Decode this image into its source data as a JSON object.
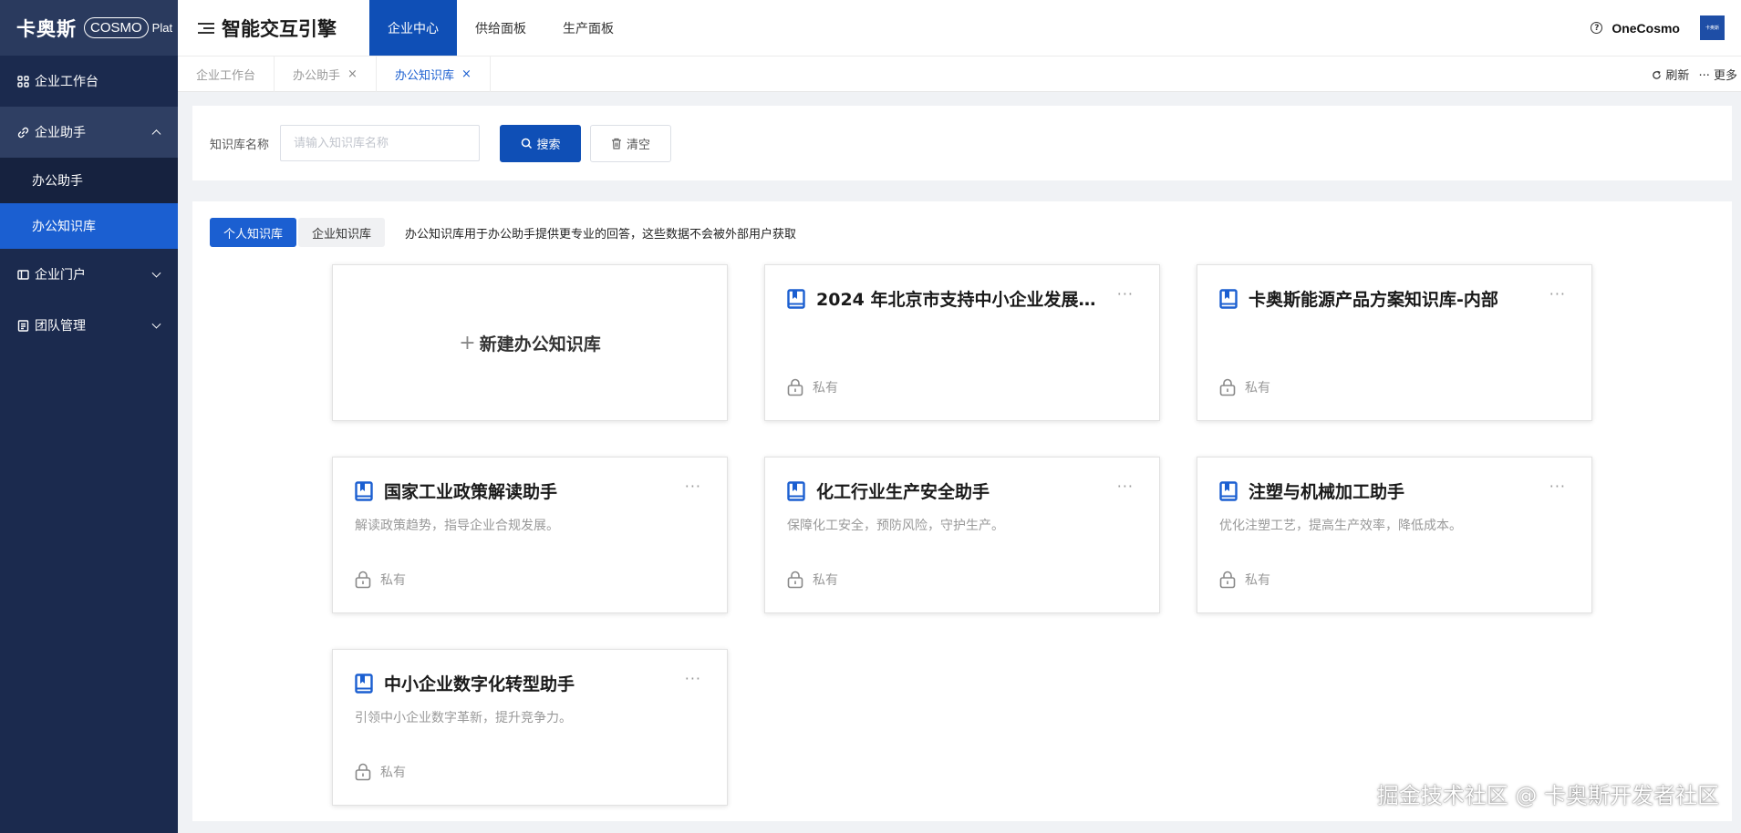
{
  "sidebar": {
    "logo_cn": "卡奥斯",
    "logo_en": "COSMO",
    "logo_plat": "Plat",
    "items": [
      {
        "label": "企业工作台",
        "icon": "grid-icon"
      },
      {
        "label": "企业助手",
        "icon": "link-icon",
        "expanded": true,
        "children": [
          {
            "label": "办公助手"
          },
          {
            "label": "办公知识库",
            "active": true
          }
        ]
      },
      {
        "label": "企业门户",
        "icon": "portal-icon"
      },
      {
        "label": "团队管理",
        "icon": "team-icon"
      }
    ]
  },
  "topbar": {
    "title": "智能交互引擎",
    "tabs": [
      {
        "label": "企业中心",
        "active": true
      },
      {
        "label": "供给面板"
      },
      {
        "label": "生产面板"
      }
    ],
    "help_glyph": "?",
    "brand": "OneCosmo",
    "avatar_text": "卡奥斯"
  },
  "page_tabs": {
    "tabs": [
      {
        "label": "企业工作台",
        "closable": false
      },
      {
        "label": "办公助手",
        "closable": true
      },
      {
        "label": "办公知识库",
        "closable": true,
        "active": true
      }
    ],
    "close_glyph": "×",
    "refresh_label": "刷新",
    "more_label": "更多"
  },
  "search": {
    "label": "知识库名称",
    "placeholder": "请输入知识库名称",
    "value": "",
    "search_label": "搜索",
    "clear_label": "清空"
  },
  "main": {
    "segments": [
      {
        "label": "个人知识库",
        "active": true
      },
      {
        "label": "企业知识库"
      }
    ],
    "description": "办公知识库用于办公助手提供更专业的回答，这些数据不会被外部用户获取",
    "new_card_plus": "+",
    "new_card_label": "新建办公知识库",
    "more_glyph": "···",
    "cards": [
      {
        "title": "2024 年北京市支持中小企业发展…",
        "desc": "",
        "visibility": "私有"
      },
      {
        "title": "卡奥斯能源产品方案知识库-内部",
        "desc": "",
        "visibility": "私有"
      },
      {
        "title": "国家工业政策解读助手",
        "desc": "解读政策趋势，指导企业合规发展。",
        "visibility": "私有"
      },
      {
        "title": "化工行业生产安全助手",
        "desc": "保障化工安全，预防风险，守护生产。",
        "visibility": "私有"
      },
      {
        "title": "注塑与机械加工助手",
        "desc": "优化注塑工艺，提高生产效率，降低成本。",
        "visibility": "私有"
      },
      {
        "title": "中小企业数字化转型助手",
        "desc": "引领中小企业数字革新，提升竞争力。",
        "visibility": "私有"
      }
    ]
  },
  "watermark": "掘金技术社区 @ 卡奥斯开发者社区",
  "colors": {
    "sidebar_bg": "#1b2a4e",
    "primary": "#1b5fd1",
    "primary_dark": "#0f4fb6",
    "page_bg": "#f0f2f5"
  }
}
